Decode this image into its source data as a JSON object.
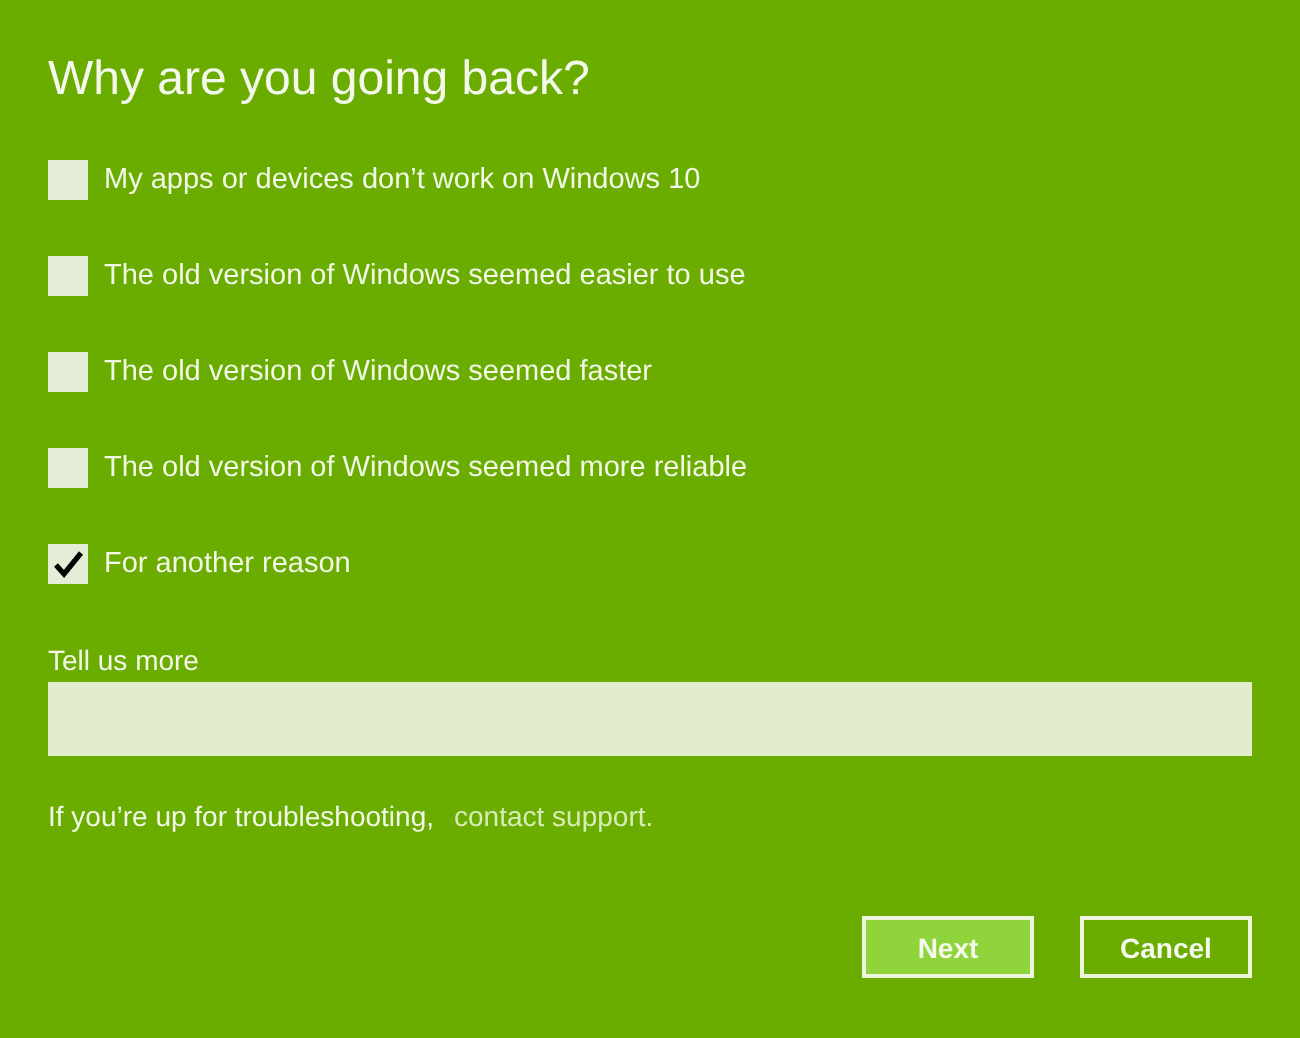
{
  "title": "Why are you going back?",
  "reasons": [
    {
      "label": "My apps or devices don’t work on Windows 10",
      "checked": false
    },
    {
      "label": "The old version of Windows seemed easier to use",
      "checked": false
    },
    {
      "label": "The old version of Windows seemed faster",
      "checked": false
    },
    {
      "label": "The old version of Windows seemed more reliable",
      "checked": false
    },
    {
      "label": "For another reason",
      "checked": true
    }
  ],
  "details": {
    "label": "Tell us more"
  },
  "help": {
    "text": "If you’re up for troubleshooting,",
    "link": "contact support."
  },
  "buttons": [
    {
      "label": "Next",
      "default": true
    },
    {
      "label": "Cancel",
      "default": false
    }
  ]
}
